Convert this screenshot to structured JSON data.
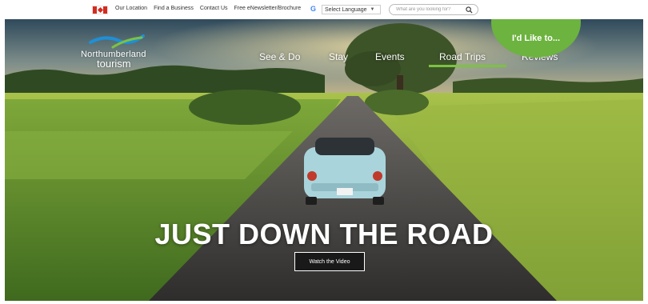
{
  "topbar": {
    "links": [
      "Our Location",
      "Find a Business",
      "Contact Us",
      "Free eNewsletter/Brochure"
    ],
    "language_label": "Select Language",
    "search_placeholder": "What are you looking for?"
  },
  "logo": {
    "line1": "Northumberland",
    "line2": "tourism"
  },
  "nav": {
    "items": [
      "See & Do",
      "Stay",
      "Events",
      "Road Trips",
      "Reviews"
    ],
    "active": "Road Trips"
  },
  "cta": {
    "like_label": "I'd Like to..."
  },
  "hero": {
    "headline": "JUST DOWN THE ROAD",
    "button_label": "Watch the Video"
  },
  "colors": {
    "accent_green": "#7cc243",
    "cta_green": "#6cb33f",
    "flag_red": "#d52b1e",
    "logo_blue": "#1f8fd6"
  },
  "icons": [
    "canada-flag-icon",
    "google-translate-icon",
    "chevron-down-icon",
    "search-icon"
  ]
}
